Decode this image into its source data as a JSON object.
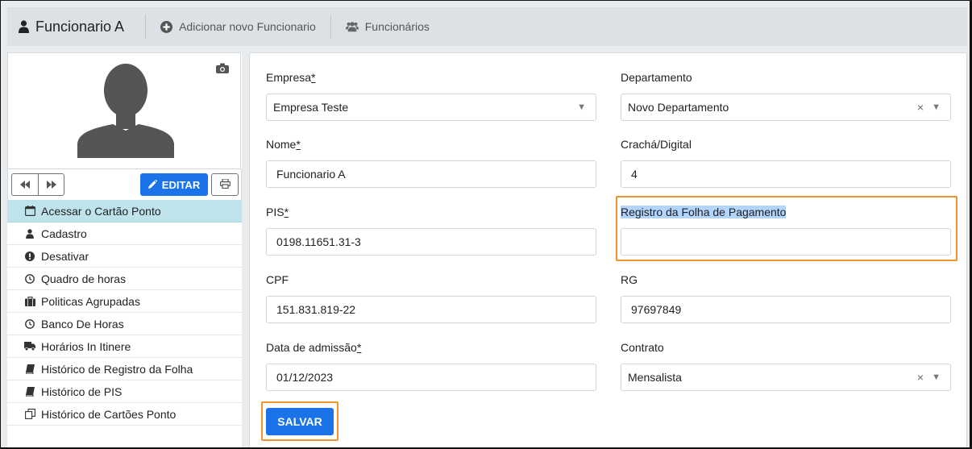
{
  "tabs": {
    "current": "Funcionario A",
    "add": "Adicionar novo Funcionario",
    "list": "Funcionários"
  },
  "sidebar": {
    "edit_label": "EDITAR",
    "items": [
      {
        "label": "Acessar o Cartão Ponto",
        "icon": "calendar-icon"
      },
      {
        "label": "Cadastro",
        "icon": "user-icon"
      },
      {
        "label": "Desativar",
        "icon": "exclamation-circle-icon"
      },
      {
        "label": "Quadro de horas",
        "icon": "clock-icon"
      },
      {
        "label": "Politicas Agrupadas",
        "icon": "briefcase-icon"
      },
      {
        "label": "Banco De Horas",
        "icon": "clock-icon"
      },
      {
        "label": "Horários In Itinere",
        "icon": "truck-icon"
      },
      {
        "label": "Histórico de Registro da Folha",
        "icon": "book-icon"
      },
      {
        "label": "Histórico de PIS",
        "icon": "book-icon"
      },
      {
        "label": "Histórico de Cartões Ponto",
        "icon": "copy-icon"
      }
    ]
  },
  "form": {
    "empresa": {
      "label": "Empresa",
      "req": "*",
      "value": "Empresa Teste"
    },
    "departamento": {
      "label": "Departamento",
      "value": "Novo Departamento"
    },
    "nome": {
      "label": "Nome",
      "req": "*",
      "value": "Funcionario A"
    },
    "cracha": {
      "label": "Crachá/Digital",
      "value": "4"
    },
    "pis": {
      "label": "PIS",
      "req": "*",
      "value": "0198.11651.31-3"
    },
    "registro": {
      "label": "Registro da Folha de Pagamento",
      "value": ""
    },
    "cpf": {
      "label": "CPF",
      "value": "151.831.819-22"
    },
    "rg": {
      "label": "RG",
      "value": "97697849"
    },
    "admissao": {
      "label": "Data de admissão",
      "req": "*",
      "value": "01/12/2023"
    },
    "contrato": {
      "label": "Contrato",
      "value": "Mensalista"
    },
    "save_label": "SALVAR"
  },
  "colors": {
    "primary": "#1a73e8",
    "highlight_box": "#f0932b",
    "active_menu": "#bfe3ea"
  }
}
